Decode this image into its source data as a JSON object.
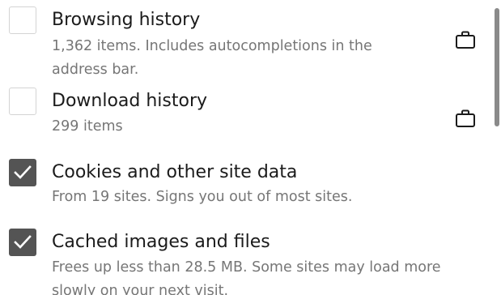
{
  "items": [
    {
      "title": "Browsing history",
      "description": "1,362 items. Includes autocompletions in the address bar.",
      "checked": false,
      "icon": "briefcase-icon"
    },
    {
      "title": "Download history",
      "description": "299 items",
      "checked": false,
      "icon": "briefcase-icon"
    },
    {
      "title": "Cookies and other site data",
      "description": "From 19 sites. Signs you out of most sites.",
      "checked": true
    },
    {
      "title": "Cached images and files",
      "description": "Frees up less than 28.5 MB. Some sites may load more slowly on your next visit.",
      "checked": true
    }
  ],
  "colors": {
    "checkbox_checked": "#545454",
    "checkbox_border": "#d4d4d4",
    "title_text": "#1b1b1b",
    "description_text": "#767676",
    "scrollbar": "#8a8a8a"
  }
}
